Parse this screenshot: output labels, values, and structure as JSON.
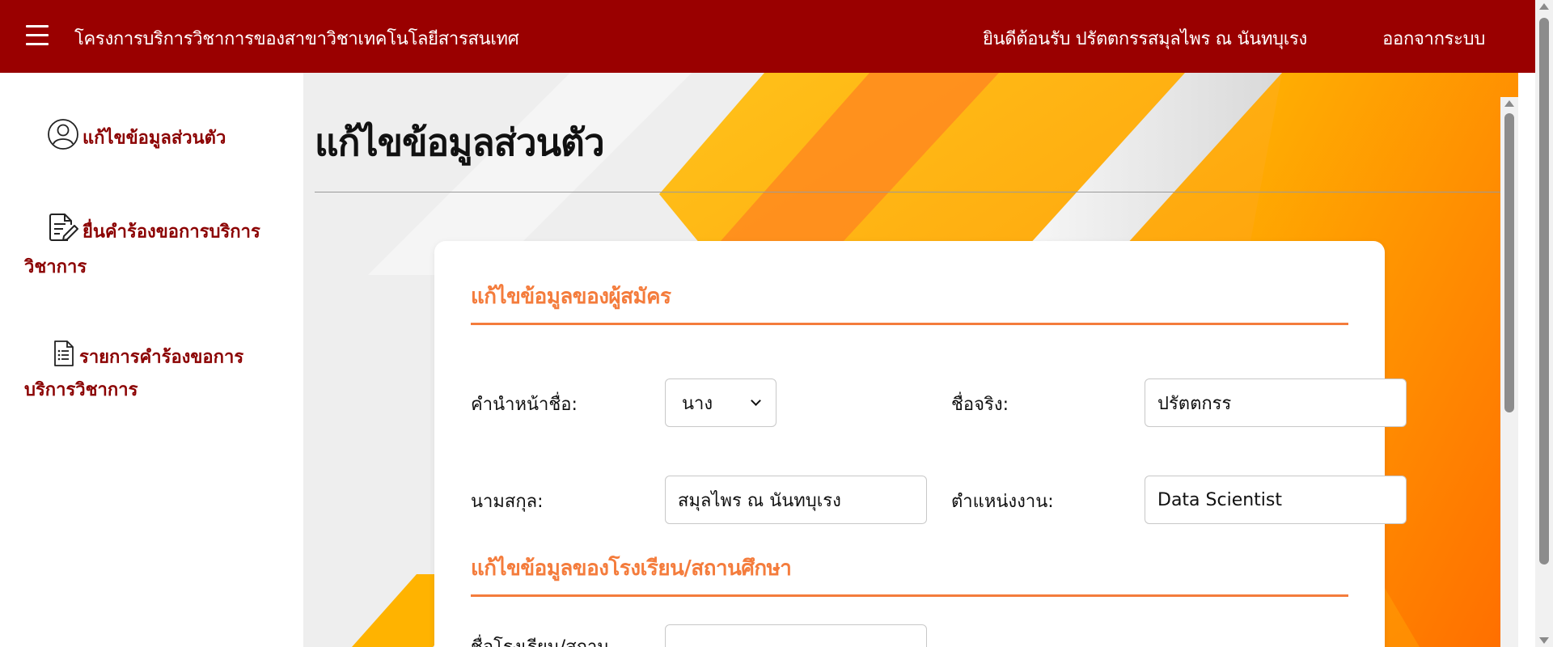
{
  "header": {
    "app_title": "โครงการบริการวิชาการของสาขาวิชาเทคโนโลยีสารสนเทศ",
    "welcome_text": "ยินดีต้อนรับ ปรัตตกรรสมุลไพร ณ นันทบุเรง",
    "logout_label": "ออกจากระบบ",
    "bg_color": "#9a0000"
  },
  "sidebar": {
    "items": [
      {
        "label": "แก้ไขข้อมูลส่วนตัว",
        "icon": "user-circle-icon"
      },
      {
        "label": "ยื่นคำร้องขอการบริการวิชาการ",
        "icon": "edit-document-icon"
      },
      {
        "label": "รายการคำร้องขอการบริการวิชาการ",
        "icon": "list-document-icon"
      }
    ]
  },
  "main": {
    "page_title": "แก้ไขข้อมูลส่วนตัว",
    "sections": [
      {
        "heading": "แก้ไขข้อมูลของผู้สมัคร"
      },
      {
        "heading": "แก้ไขข้อมูลของโรงเรียน/สถานศึกษา"
      }
    ],
    "form": {
      "prefix_label": "คำนำหน้าชื่อ:",
      "prefix_value": "นาง",
      "firstname_label": "ชื่อจริง:",
      "firstname_value": "ปรัตตกรร",
      "lastname_label": "นามสกุล:",
      "lastname_value": "สมุลไพร ณ นันทบุเรง",
      "position_label": "ตำแหน่งงาน:",
      "position_value": "Data Scientist",
      "school_label": "ชื่อโรงเรียน/สถาน",
      "school_value_partial": ""
    },
    "accent_color": "#f47c3c",
    "label_color": "#8b0000"
  }
}
